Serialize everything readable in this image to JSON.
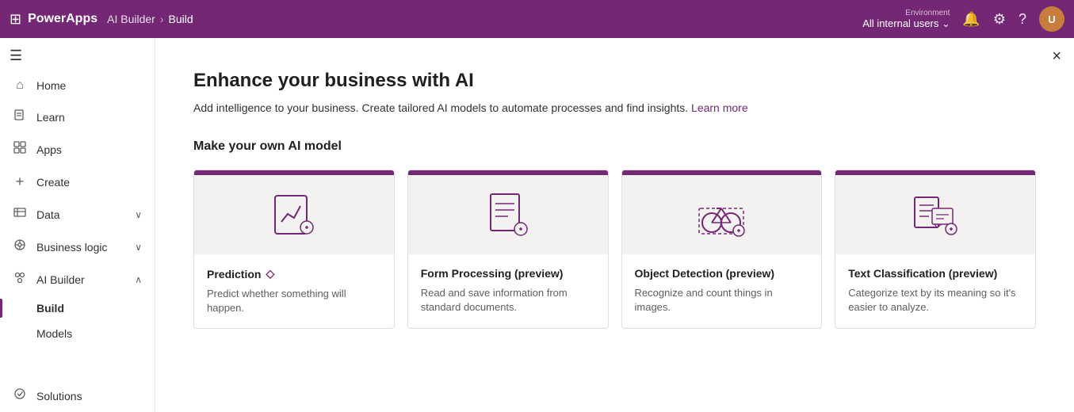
{
  "topbar": {
    "app_name": "PowerApps",
    "breadcrumb": [
      {
        "label": "AI Builder",
        "current": false
      },
      {
        "label": "Build",
        "current": true
      }
    ],
    "environment_label": "Environment",
    "environment_value": "All internal users",
    "avatar_initials": "U"
  },
  "sidebar": {
    "collapse_icon": "≡",
    "items": [
      {
        "id": "home",
        "label": "Home",
        "icon": "⌂",
        "has_chevron": false,
        "active": false
      },
      {
        "id": "learn",
        "label": "Learn",
        "icon": "📖",
        "has_chevron": false,
        "active": false
      },
      {
        "id": "apps",
        "label": "Apps",
        "icon": "🗂",
        "has_chevron": false,
        "active": false
      },
      {
        "id": "create",
        "label": "Create",
        "icon": "+",
        "has_chevron": false,
        "active": false
      },
      {
        "id": "data",
        "label": "Data",
        "icon": "⊞",
        "has_chevron": true,
        "active": false
      },
      {
        "id": "business-logic",
        "label": "Business logic",
        "icon": "⚙",
        "has_chevron": true,
        "active": false
      },
      {
        "id": "ai-builder",
        "label": "AI Builder",
        "icon": "◈",
        "has_chevron": true,
        "active": false
      }
    ],
    "sub_items": [
      {
        "id": "build",
        "label": "Build",
        "active": true
      },
      {
        "id": "models",
        "label": "Models",
        "active": false
      }
    ],
    "bottom_items": [
      {
        "id": "solutions",
        "label": "Solutions",
        "icon": "⬡"
      }
    ]
  },
  "content": {
    "close_button": "×",
    "title": "Enhance your business with AI",
    "subtitle_text": "Add intelligence to your business. Create tailored AI models to automate processes and find insights.",
    "subtitle_link": "Learn more",
    "section_title": "Make your own AI model",
    "cards": [
      {
        "id": "prediction",
        "title": "Prediction",
        "has_diamond": true,
        "description": "Predict whether something will happen."
      },
      {
        "id": "form-processing",
        "title": "Form Processing (preview)",
        "has_diamond": false,
        "description": "Read and save information from standard documents."
      },
      {
        "id": "object-detection",
        "title": "Object Detection (preview)",
        "has_diamond": false,
        "description": "Recognize and count things in images."
      },
      {
        "id": "text-classification",
        "title": "Text Classification (preview)",
        "has_diamond": false,
        "description": "Categorize text by its meaning so it's easier to analyze."
      }
    ]
  }
}
